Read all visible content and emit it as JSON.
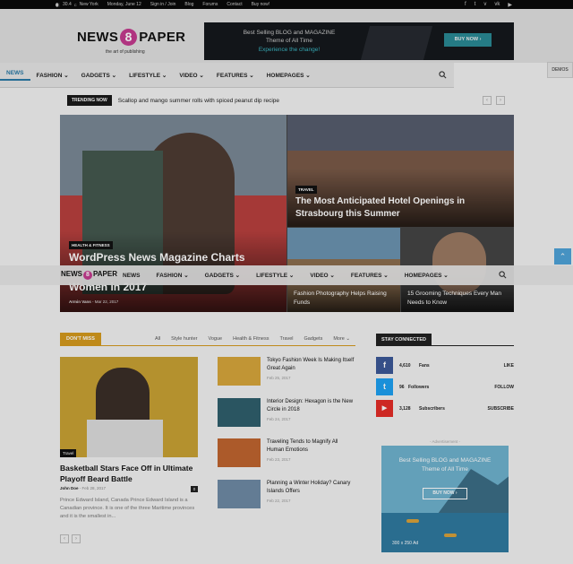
{
  "topbar": {
    "temperature": "30.4",
    "temp_unit": "C",
    "city": "New York",
    "date": "Monday, June 12",
    "links": [
      "Sign in / Join",
      "Blog",
      "Forums",
      "Contact",
      "Buy now!"
    ],
    "social_icons": [
      "facebook-icon",
      "twitter-icon",
      "vimeo-icon",
      "vk-icon",
      "youtube-icon"
    ]
  },
  "logo": {
    "part1": "NEWS",
    "eight": "8",
    "part2": "PAPER",
    "tagline": "the art of publishing"
  },
  "banner": {
    "line1": "Best Selling BLOG and MAGAZINE",
    "line2": "Theme of All Time",
    "line3": "Experience the change!",
    "button": "BUY NOW ›"
  },
  "menu": {
    "items": [
      "NEWS",
      "FASHION",
      "GADGETS",
      "LIFESTYLE",
      "VIDEO",
      "FEATURES",
      "HOMEPAGES"
    ],
    "active": "NEWS"
  },
  "demos": "DEMOS",
  "trending": {
    "label": "TRENDING NOW",
    "headline": "Scallop and mango summer rolls with spiced peanut dip recipe",
    "prev": "‹",
    "next": "›"
  },
  "featured": {
    "big": {
      "category": "HEALTH & FITNESS",
      "title": "WordPress News Magazine Charts",
      "title2": "Women in 2017",
      "author": "Armin Vans",
      "date": "Mar 22, 2017"
    },
    "top_right": {
      "category": "TRAVEL",
      "title": "The Most Anticipated Hotel Openings in Strasbourg this Summer"
    },
    "bottom_left": {
      "title": "Fashion Photography Helps Raising Funds"
    },
    "bottom_right": {
      "title": "15 Grooming Techniques Every Man Needs to Know"
    }
  },
  "sticky_menu": {
    "items": [
      "NEWS",
      "FASHION",
      "GADGETS",
      "LIFESTYLE",
      "VIDEO",
      "FEATURES",
      "HOMEPAGES"
    ]
  },
  "scroll_up": "⌃",
  "dont_miss": {
    "label": "DON'T MISS",
    "tabs": [
      "All",
      "Style hunter",
      "Vogue",
      "Health & Fitness",
      "Travel",
      "Gadgets",
      "More"
    ],
    "main": {
      "category": "Travel",
      "title": "Basketball Stars Face Off in Ultimate Playoff Beard Battle",
      "author": "John Doe",
      "date": "Feb 28, 2017",
      "comments": "0",
      "excerpt": "Prince Edward Island, Canada Prince Edward Island is a Canadian province. It is one of the three Maritime provinces and it is the smallest in..."
    },
    "list": [
      {
        "title": "Tokyo Fashion Week Is Making Itself Great Again",
        "date": "Feb 25, 2017"
      },
      {
        "title": "Interior Design: Hexagon is the New Circle in 2018",
        "date": "Feb 24, 2017"
      },
      {
        "title": "Traveling Tends to Magnify All Human Emotions",
        "date": "Feb 23, 2017"
      },
      {
        "title": "Planning a Winter Holiday? Canary Islands Offers",
        "date": "Feb 22, 2017"
      }
    ],
    "prev": "‹",
    "next": "›"
  },
  "stay_connected": {
    "label": "STAY CONNECTED",
    "rows": [
      {
        "icon": "facebook-icon",
        "glyph": "f",
        "count": "4,610",
        "label": "Fans",
        "action": "LIKE",
        "color": "#3b5998"
      },
      {
        "icon": "twitter-icon",
        "glyph": "t",
        "count": "96",
        "label": "Followers",
        "action": "FOLLOW",
        "color": "#1da1f2"
      },
      {
        "icon": "youtube-icon",
        "glyph": "▶",
        "count": "3,128",
        "label": "Subscribers",
        "action": "SUBSCRIBE",
        "color": "#e52d27"
      }
    ]
  },
  "advertisement": {
    "label": "- Advertisement -",
    "line1": "Best Selling BLOG and MAGAZINE",
    "line2": "Theme of All Time",
    "button": "BUY NOW ›",
    "size": "300 x 250 Ad"
  }
}
